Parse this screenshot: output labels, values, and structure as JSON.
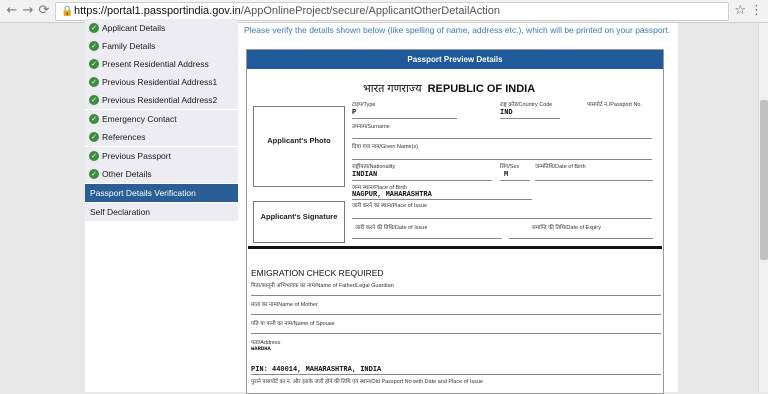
{
  "browser": {
    "url_host": "https://portal1.passportindia.gov.in",
    "url_path": "/AppOnlineProject/secure/ApplicantOtherDetailAction",
    "lock_icon": "lock-icon",
    "back": "←",
    "forward": "→",
    "reload": "⟳",
    "star": "☆",
    "menu": "⋮"
  },
  "sidebar": {
    "items": [
      {
        "label": "Applicant Details",
        "done": true
      },
      {
        "label": "Family Details",
        "done": true
      },
      {
        "label": "Present Residential Address",
        "done": true
      },
      {
        "label": "Previous Residential Address1",
        "done": true
      },
      {
        "label": "Previous Residential Address2",
        "done": true
      },
      {
        "label": "Emergency Contact",
        "done": true
      },
      {
        "label": "References",
        "done": true
      },
      {
        "label": "Previous Passport",
        "done": true
      },
      {
        "label": "Other Details",
        "done": true
      },
      {
        "label": "Passport Details Verification",
        "active": true
      },
      {
        "label": "Self Declaration"
      }
    ]
  },
  "main": {
    "notice": "Please verify the details shown below (like spelling of name, address etc.), which will be printed on your passport.",
    "panel_title": "Passport Preview Details",
    "doc_title_hi": "भारत गणराज्य",
    "doc_title_en": "REPUBLIC OF INDIA",
    "photo_label": "Applicant's Photo",
    "signature_label": "Applicant's Signature",
    "fields": {
      "type_label": "टाइप/Type",
      "type_value": "P",
      "country_label": "राष्ट्र कोड/Country Code",
      "country_value": "IND",
      "passport_no_label": "पासपोर्ट नं./Passport No.",
      "surname_label": "उपनाम/Surname",
      "given_label": "दिया गया नाम/Given Name(s)",
      "nationality_label": "राष्ट्रीयता/Nationality",
      "nationality_value": "INDIAN",
      "sex_label": "लिंग/Sex",
      "sex_value": "M",
      "dob_label": "जन्मतिथि/Date of Birth",
      "pob_label": "जन्म स्थान/Place of Birth",
      "pob_value": "NAGPUR, MAHARASHTRA",
      "poi_label": "जारी करने का स्थान/Place of Issue",
      "doi_label": "जारी करने की तिथि/Date of Issue",
      "doe_label": "समाप्ति की तिथि/Date of Expiry"
    },
    "emigration": "EMIGRATION CHECK REQUIRED",
    "father_label": "पिता/कानूनी अभिभावक का नाम/Name of Father/Legal Guardian",
    "mother_label": "माता का नाम/Name of Mother",
    "spouse_label": "पति या पत्नी का नाम/Name of Spouse",
    "address_label": "पता/Address",
    "address_cut": "WARDHA",
    "pin_line": "PIN: 440014, MAHARASHTRA, INDIA",
    "old_passport_label": "पुराने पासपोर्ट का नं. और इसके जारी होने की तिथि एवं स्थान/Old Passport No with Date and Place of Issue"
  }
}
